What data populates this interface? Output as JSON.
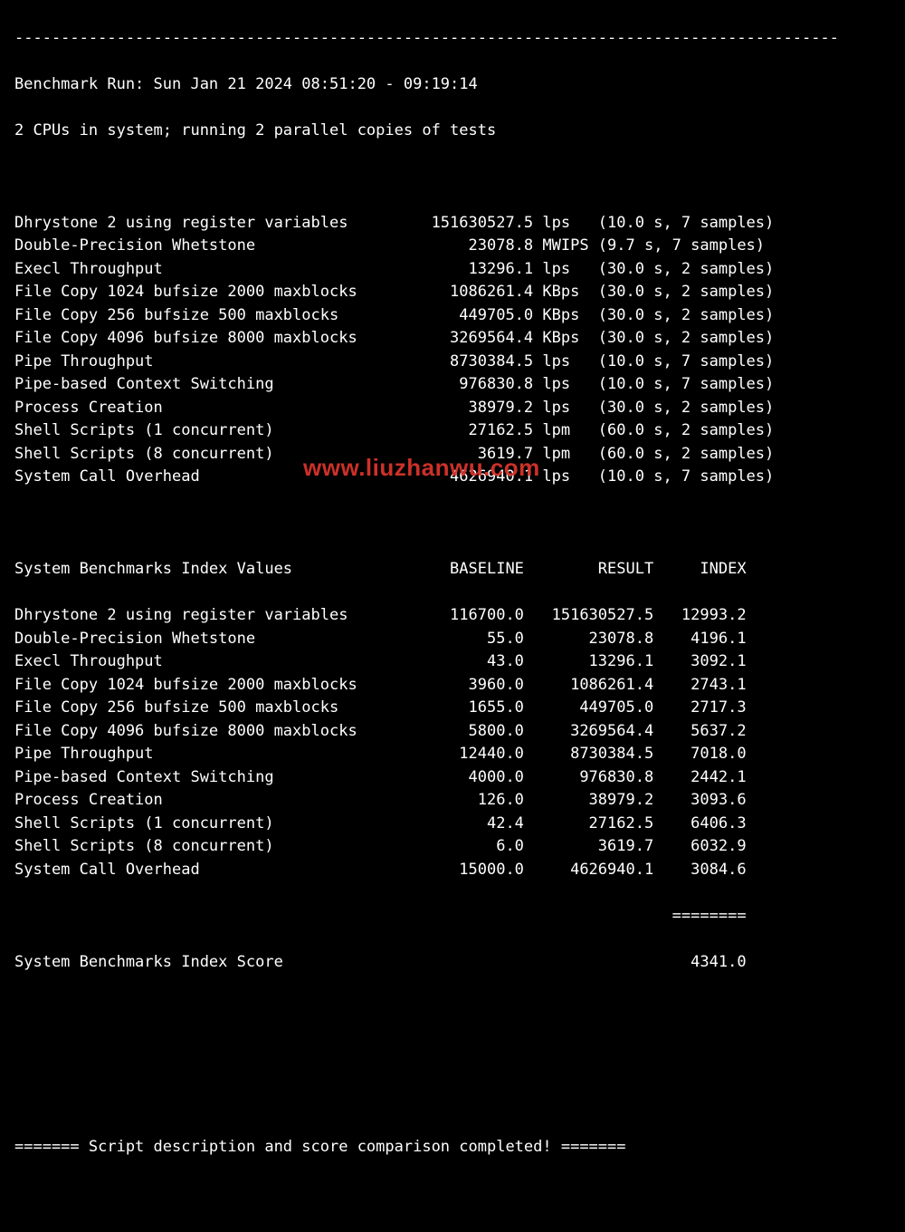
{
  "header": {
    "run_line": "Benchmark Run: Sun Jan 21 2024 08:51:20 - 09:19:14",
    "cpu_line": "2 CPUs in system; running 2 parallel copies of tests"
  },
  "tests": [
    {
      "name": "Dhrystone 2 using register variables",
      "value": "151630527.5",
      "unit": "lps",
      "time": "10.0",
      "samples": "7"
    },
    {
      "name": "Double-Precision Whetstone",
      "value": "23078.8",
      "unit": "MWIPS",
      "time": "9.7",
      "samples": "7"
    },
    {
      "name": "Execl Throughput",
      "value": "13296.1",
      "unit": "lps",
      "time": "30.0",
      "samples": "2"
    },
    {
      "name": "File Copy 1024 bufsize 2000 maxblocks",
      "value": "1086261.4",
      "unit": "KBps",
      "time": "30.0",
      "samples": "2"
    },
    {
      "name": "File Copy 256 bufsize 500 maxblocks",
      "value": "449705.0",
      "unit": "KBps",
      "time": "30.0",
      "samples": "2"
    },
    {
      "name": "File Copy 4096 bufsize 8000 maxblocks",
      "value": "3269564.4",
      "unit": "KBps",
      "time": "30.0",
      "samples": "2"
    },
    {
      "name": "Pipe Throughput",
      "value": "8730384.5",
      "unit": "lps",
      "time": "10.0",
      "samples": "7"
    },
    {
      "name": "Pipe-based Context Switching",
      "value": "976830.8",
      "unit": "lps",
      "time": "10.0",
      "samples": "7"
    },
    {
      "name": "Process Creation",
      "value": "38979.2",
      "unit": "lps",
      "time": "30.0",
      "samples": "2"
    },
    {
      "name": "Shell Scripts (1 concurrent)",
      "value": "27162.5",
      "unit": "lpm",
      "time": "60.0",
      "samples": "2"
    },
    {
      "name": "Shell Scripts (8 concurrent)",
      "value": "3619.7",
      "unit": "lpm",
      "time": "60.0",
      "samples": "2"
    },
    {
      "name": "System Call Overhead",
      "value": "4626940.1",
      "unit": "lps",
      "time": "10.0",
      "samples": "7"
    }
  ],
  "index_header": {
    "title": "System Benchmarks Index Values",
    "col_baseline": "BASELINE",
    "col_result": "RESULT",
    "col_index": "INDEX"
  },
  "index_rows": [
    {
      "name": "Dhrystone 2 using register variables",
      "baseline": "116700.0",
      "result": "151630527.5",
      "index": "12993.2"
    },
    {
      "name": "Double-Precision Whetstone",
      "baseline": "55.0",
      "result": "23078.8",
      "index": "4196.1"
    },
    {
      "name": "Execl Throughput",
      "baseline": "43.0",
      "result": "13296.1",
      "index": "3092.1"
    },
    {
      "name": "File Copy 1024 bufsize 2000 maxblocks",
      "baseline": "3960.0",
      "result": "1086261.4",
      "index": "2743.1"
    },
    {
      "name": "File Copy 256 bufsize 500 maxblocks",
      "baseline": "1655.0",
      "result": "449705.0",
      "index": "2717.3"
    },
    {
      "name": "File Copy 4096 bufsize 8000 maxblocks",
      "baseline": "5800.0",
      "result": "3269564.4",
      "index": "5637.2"
    },
    {
      "name": "Pipe Throughput",
      "baseline": "12440.0",
      "result": "8730384.5",
      "index": "7018.0"
    },
    {
      "name": "Pipe-based Context Switching",
      "baseline": "4000.0",
      "result": "976830.8",
      "index": "2442.1"
    },
    {
      "name": "Process Creation",
      "baseline": "126.0",
      "result": "38979.2",
      "index": "3093.6"
    },
    {
      "name": "Shell Scripts (1 concurrent)",
      "baseline": "42.4",
      "result": "27162.5",
      "index": "6406.3"
    },
    {
      "name": "Shell Scripts (8 concurrent)",
      "baseline": "6.0",
      "result": "3619.7",
      "index": "6032.9"
    },
    {
      "name": "System Call Overhead",
      "baseline": "15000.0",
      "result": "4626940.1",
      "index": "3084.6"
    }
  ],
  "separator": "========",
  "score": {
    "label": "System Benchmarks Index Score",
    "value": "4341.0"
  },
  "footer": "======= Script description and score comparison completed! =======",
  "watermark": "www.liuzhanwu.com",
  "top_dashes": "-----------------------------------------------------------------------------------------"
}
